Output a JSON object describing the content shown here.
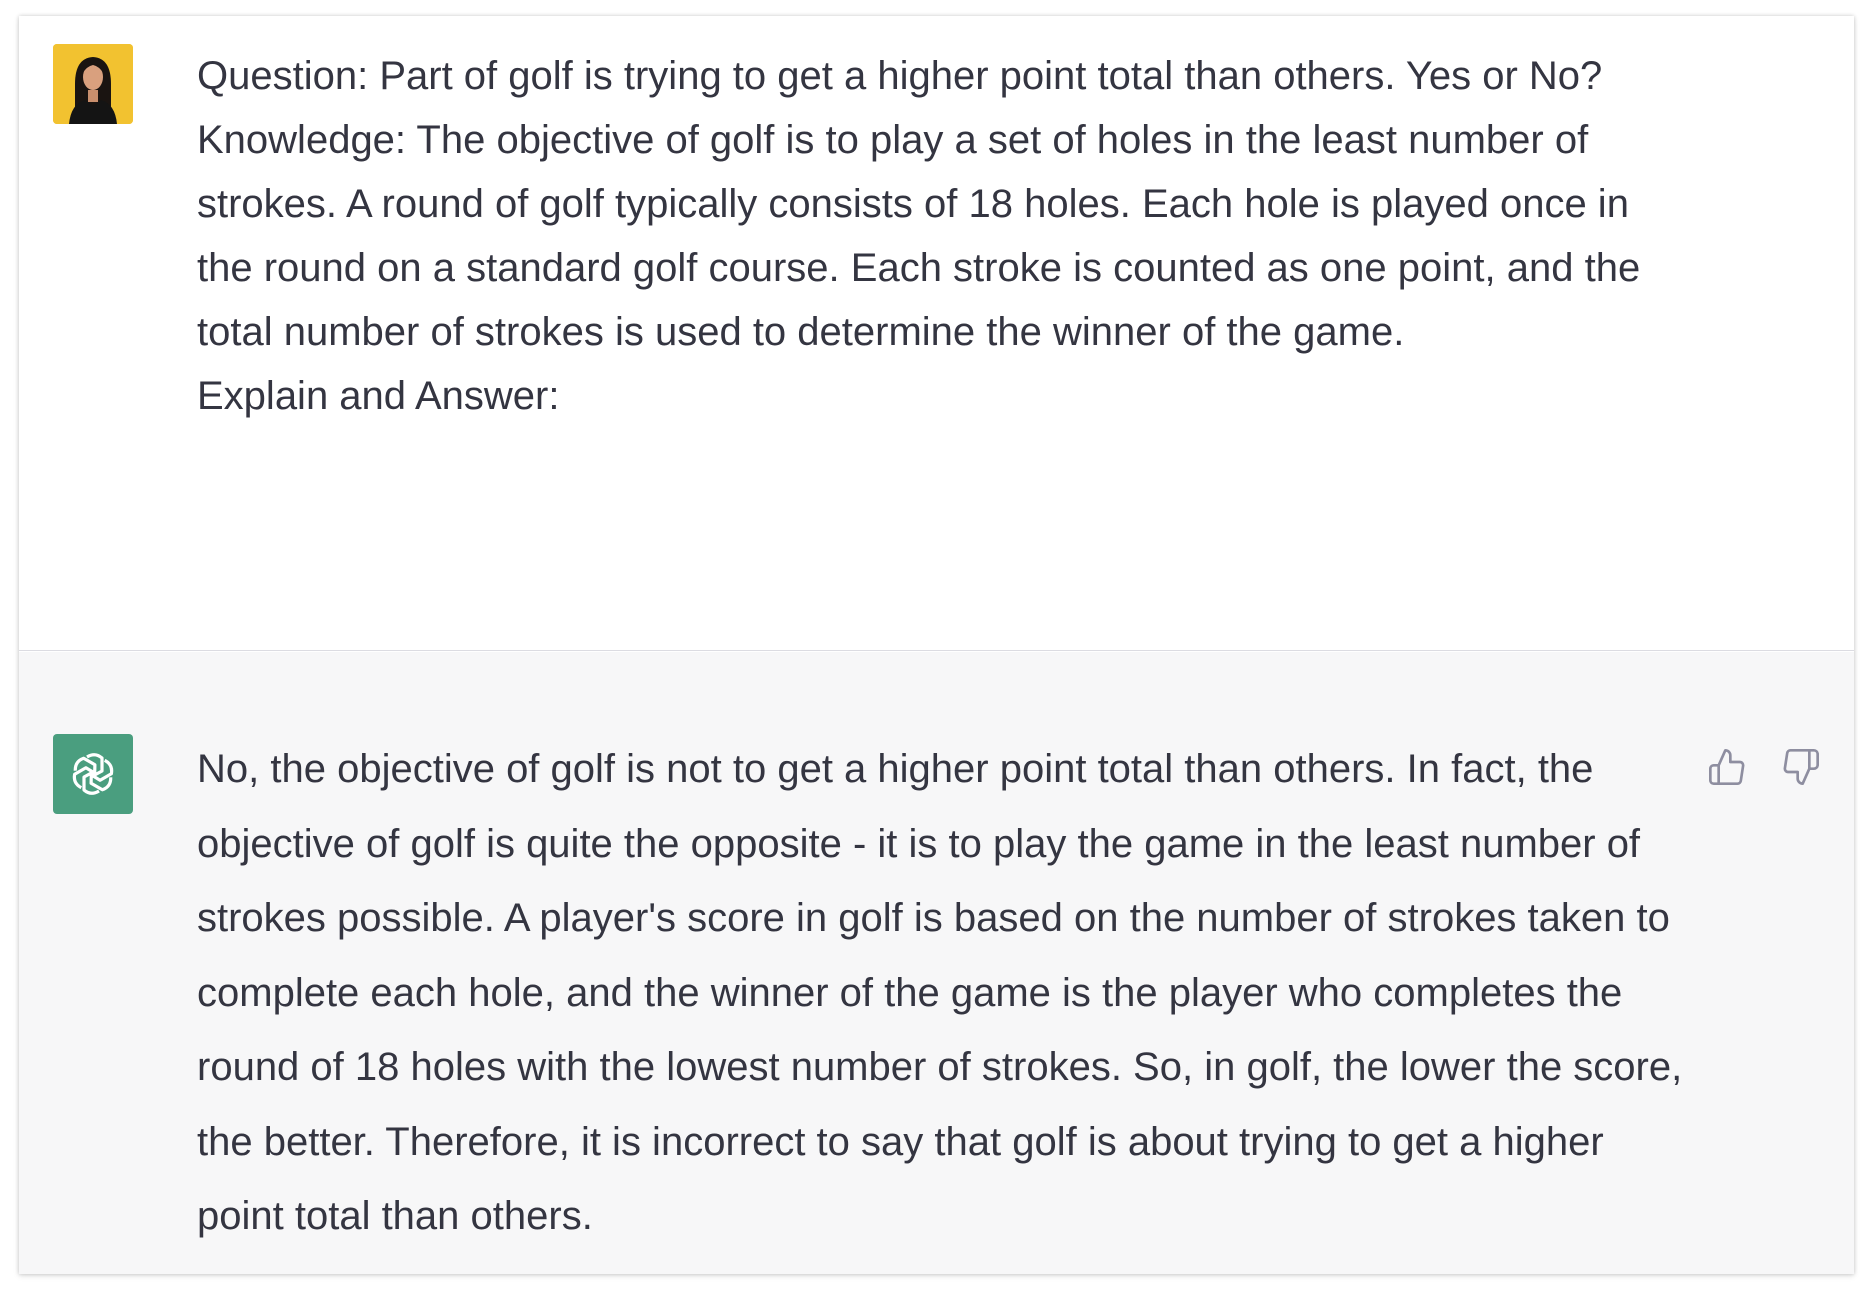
{
  "conversation": {
    "user_message": {
      "avatar_icon": "user-photo-avatar",
      "avatar_bg": "#f2c230",
      "text": "Question: Part of golf is trying to get a higher point total than others. Yes or No?\nKnowledge: The objective of golf is to play a set of holes in the least number of strokes. A round of golf typically consists of 18 holes. Each hole is played once in the round on a standard golf course. Each stroke is counted as one point, and the total number of strokes is used to determine the winner of the game.\nExplain and Answer:"
    },
    "assistant_message": {
      "avatar_icon": "openai-logo-icon",
      "avatar_bg": "#4a9e7f",
      "text": "No, the objective of golf is not to get a higher point total than others. In fact, the objective of golf is quite the opposite - it is to play the game in the least number of strokes possible. A player's score in golf is based on the number of strokes taken to complete each hole, and the winner of the game is the player who completes the round of 18 holes with the lowest number of strokes. So, in golf, the lower the score, the better. Therefore, it is incorrect to say that golf is about trying to get a higher point total than others.",
      "feedback": {
        "thumbs_up_icon": "thumbs-up-icon",
        "thumbs_down_icon": "thumbs-down-icon"
      }
    }
  }
}
